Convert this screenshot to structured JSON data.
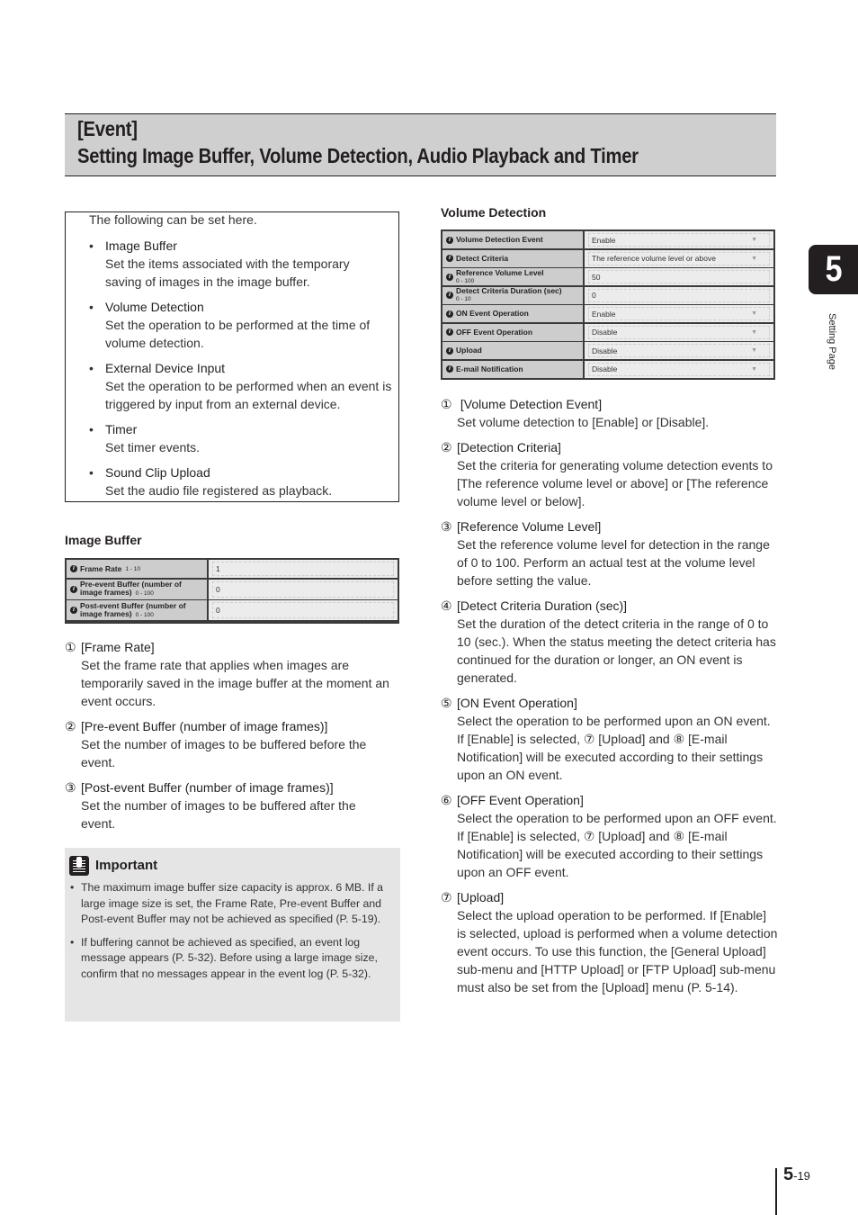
{
  "header": {
    "title_line1": "[Event]",
    "title_line2": "Setting Image Buffer, Volume Detection, Audio Playback and Timer"
  },
  "intro": {
    "lead": "The following can be set here.",
    "items": [
      {
        "name": "Image Buffer",
        "desc": "Set the items associated with the temporary saving of images in the image buffer."
      },
      {
        "name": "Volume Detection",
        "desc": "Set the operation to be performed at the time of volume detection."
      },
      {
        "name": "External Device Input",
        "desc": "Set the operation to be performed when an event is triggered by input from an external device."
      },
      {
        "name": "Timer",
        "desc": "Set timer events."
      },
      {
        "name": "Sound Clip Upload",
        "desc": "Set the audio file registered as playback."
      }
    ]
  },
  "image_buffer": {
    "heading": "Image Buffer",
    "rows": [
      {
        "label": "Frame Rate",
        "range": "1 - 10",
        "value": "1"
      },
      {
        "label": "Pre-event Buffer (number of image frames)",
        "label_a": "Pre-event Buffer (number of",
        "label_b": "image frames)",
        "range": "0 - 100",
        "value": "0"
      },
      {
        "label": "Post-event Buffer (number of image frames)",
        "label_a": "Post-event Buffer (number of",
        "label_b": "image frames)",
        "range": "0 - 100",
        "value": "0"
      }
    ],
    "descriptions": [
      {
        "num": "①",
        "head": "[Frame Rate]",
        "body": "Set the frame rate that applies when images are temporarily saved in the image buffer at the moment an event occurs."
      },
      {
        "num": "②",
        "head": "[Pre-event Buffer (number of image frames)]",
        "body": "Set the number of images to be buffered before the event."
      },
      {
        "num": "③",
        "head": "[Post-event Buffer (number of image frames)]",
        "body": "Set the number of images to be buffered after the event."
      }
    ]
  },
  "important": {
    "title": "Important",
    "notes": [
      "The maximum image buffer size capacity is approx. 6 MB. If a large image size is set, the Frame Rate, Pre-event Buffer and Post-event Buffer may not be achieved as specified (P. 5-19).",
      "If buffering cannot be achieved as specified, an event log message appears (P. 5-32). Before using a large image size, confirm that no messages appear in the event log (P. 5-32)."
    ]
  },
  "volume_detection": {
    "heading": "Volume Detection",
    "rows": [
      {
        "label": "Volume Detection Event",
        "value": "Enable",
        "type": "select"
      },
      {
        "label": "Detect Criteria",
        "value": "The reference volume level or above",
        "type": "select"
      },
      {
        "label": "Reference Volume Level",
        "range": "0 - 100",
        "value": "50",
        "type": "text"
      },
      {
        "label": "Detect Criteria Duration (sec)",
        "range": "0 - 10",
        "value": "0",
        "type": "text"
      },
      {
        "label": "ON Event Operation",
        "value": "Enable",
        "type": "select"
      },
      {
        "label": "OFF Event Operation",
        "value": "Disable",
        "type": "select"
      },
      {
        "label": "Upload",
        "value": "Disable",
        "type": "select"
      },
      {
        "label": "E-mail Notification",
        "value": "Disable",
        "type": "select"
      }
    ],
    "descriptions": [
      {
        "num": "①",
        "head": " [Volume Detection Event]",
        "body": "Set volume detection to [Enable] or [Disable]."
      },
      {
        "num": "②",
        "head": "[Detection Criteria]",
        "body": "Set the criteria for generating volume detection events to [The reference volume level or above] or [The reference volume level or below]."
      },
      {
        "num": "③",
        "head": "[Reference Volume Level]",
        "body": "Set the reference volume level for detection in the range of 0 to 100. Perform an actual test at the volume level before setting the value."
      },
      {
        "num": "④",
        "head": "[Detect Criteria Duration (sec)]",
        "body": "Set the duration of the detect criteria in the range of 0 to 10 (sec.). When the status meeting the detect criteria has continued for the duration or longer, an ON event is generated."
      },
      {
        "num": "⑤",
        "head": "[ON Event Operation]",
        "body": "Select the operation to be performed upon an ON event. If [Enable] is selected, ⑦ [Upload] and ⑧ [E-mail Notification] will be executed according to their settings upon an ON event."
      },
      {
        "num": "⑥",
        "head": "[OFF Event Operation]",
        "body": "Select the operation to be performed upon an OFF event. If [Enable] is selected, ⑦ [Upload] and ⑧ [E-mail Notification] will be executed according to their settings upon an OFF event."
      },
      {
        "num": "⑦",
        "head": "[Upload]",
        "body": "Select the upload operation to be performed. If [Enable] is selected, upload is performed when a volume detection event occurs. To use this function, the [General Upload] sub-menu and [HTTP Upload] or [FTP Upload] sub-menu must also be set from the [Upload] menu (P. 5-14)."
      }
    ]
  },
  "side": {
    "chapter": "5",
    "label": "Setting Page"
  },
  "footer": {
    "chapter": "5",
    "page": "-19"
  }
}
